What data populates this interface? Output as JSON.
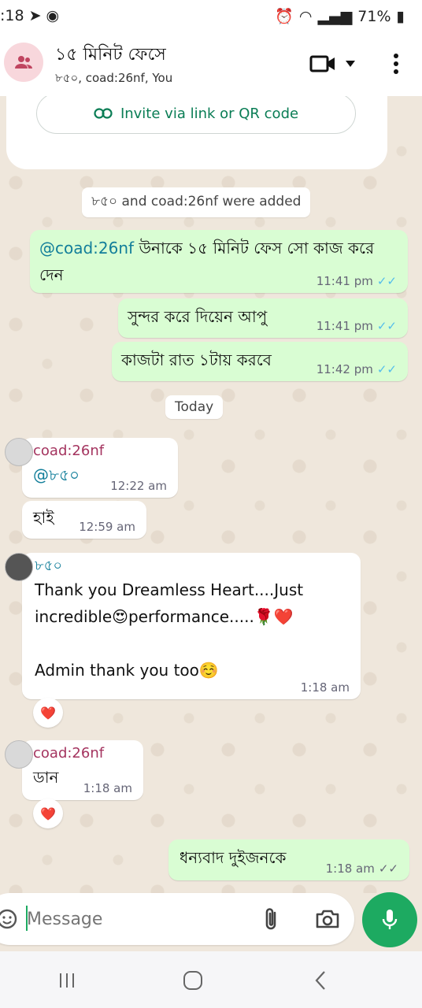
{
  "status": {
    "time": ":18",
    "battery": "71%"
  },
  "header": {
    "title": "১৫ মিনিট ফেসে",
    "subtitle": "৮৫০, coad:26nf, You"
  },
  "invite": {
    "label": "Invite via link or QR code"
  },
  "system": {
    "added": "৮৫০ and coad:26nf were added",
    "today": "Today"
  },
  "messages": {
    "m1": {
      "mention": "@coad:26nf",
      "text": " উনাকে ১৫ মিনিট ফেস সো কাজ করে দেন",
      "time": "11:41 pm"
    },
    "m2": {
      "text": "সুন্দর করে দিয়েন আপু",
      "time": "11:41 pm"
    },
    "m3": {
      "text": "কাজটা রাত ১টায় করবে",
      "time": "11:42 pm"
    },
    "m4": {
      "sender": "coad:26nf",
      "text": "@৮৫০",
      "time": "12:22 am"
    },
    "m5": {
      "text": "হাই",
      "time": "12:59 am"
    },
    "m6": {
      "sender": "৮৫০",
      "line1": "Thank you Dreamless Heart....Just",
      "line2": "incredible😍performance.....🌹❤️",
      "line3": "Admin thank you too☺️",
      "time": "1:18 am"
    },
    "m7": {
      "sender": "coad:26nf",
      "text": "ডান",
      "time": "1:18 am"
    },
    "m8": {
      "text": "ধন্যবাদ দুইজনকে",
      "time": "1:18 am"
    }
  },
  "reactions": {
    "r1": "❤️",
    "r2": "❤️"
  },
  "input": {
    "placeholder": "Message"
  },
  "colors": {
    "accent": "#1daa61",
    "bubble_out": "#d9fdd3",
    "tick_read": "#53bdeb"
  }
}
